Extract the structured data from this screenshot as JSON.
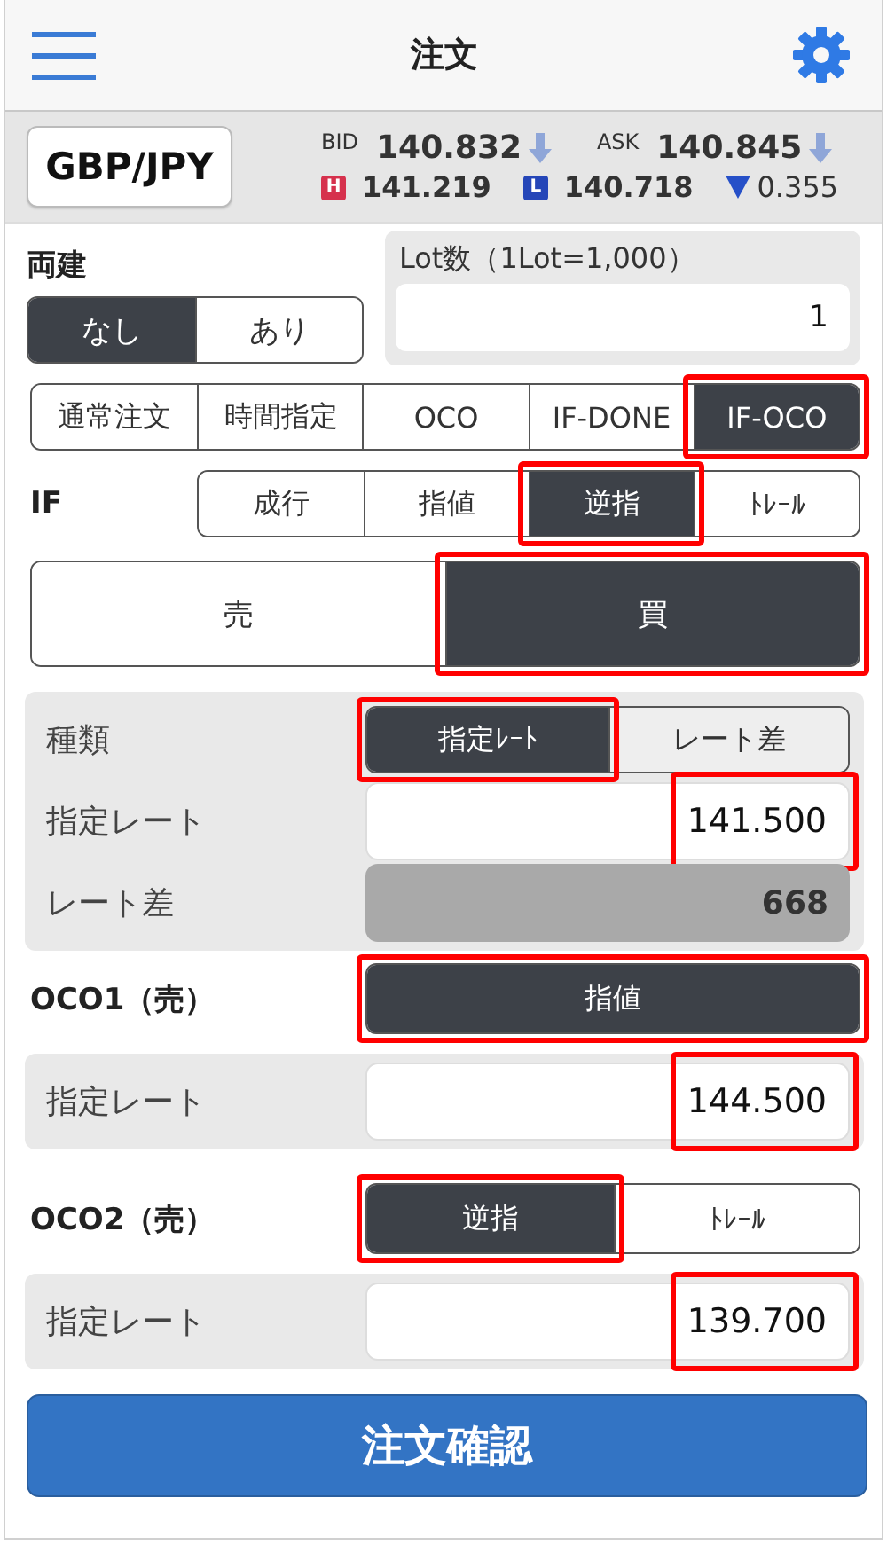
{
  "header": {
    "title": "注文"
  },
  "quote": {
    "pair": "GBP/JPY",
    "bid_label": "BID",
    "bid": "140.832",
    "bid_falling": true,
    "ask_label": "ASK",
    "ask": "140.845",
    "ask_falling": true,
    "high_badge": "H",
    "high": "141.219",
    "low_badge": "L",
    "low": "140.718",
    "change_falling": true,
    "change": "0.355"
  },
  "hedge": {
    "label": "両建",
    "options": [
      {
        "label": "なし",
        "selected": true
      },
      {
        "label": "あり",
        "selected": false
      }
    ]
  },
  "lot": {
    "label": "Lot数（1Lot=1,000）",
    "value": "1"
  },
  "order_types": [
    {
      "label": "通常注文",
      "selected": false,
      "highlighted": false
    },
    {
      "label": "時間指定",
      "selected": false,
      "highlighted": false
    },
    {
      "label": "OCO",
      "selected": false,
      "highlighted": false
    },
    {
      "label": "IF-DONE",
      "selected": false,
      "highlighted": false
    },
    {
      "label": "IF-OCO",
      "selected": true,
      "highlighted": true
    }
  ],
  "if_section": {
    "label": "IF",
    "methods": [
      {
        "label": "成行",
        "selected": false,
        "highlighted": false
      },
      {
        "label": "指値",
        "selected": false,
        "highlighted": false
      },
      {
        "label": "逆指",
        "selected": true,
        "highlighted": true
      },
      {
        "label": "ﾄﾚｰﾙ",
        "selected": false,
        "highlighted": false
      }
    ]
  },
  "sides": [
    {
      "label": "売",
      "selected": false,
      "highlighted": false
    },
    {
      "label": "買",
      "selected": true,
      "highlighted": true
    }
  ],
  "if_rate_panel": {
    "rows": [
      {
        "kind": "segmented",
        "label": "種類",
        "options": [
          {
            "label": "指定ﾚｰﾄ",
            "selected": true,
            "highlighted": true
          },
          {
            "label": "レート差",
            "selected": false,
            "highlighted": false
          }
        ]
      },
      {
        "kind": "input",
        "label": "指定レート",
        "value": "141.500",
        "highlighted": true
      },
      {
        "kind": "readonly",
        "label": "レート差",
        "value": "668"
      }
    ]
  },
  "oco1": {
    "label": "OCO1（売）",
    "methods": [
      {
        "label": "指値",
        "selected": true,
        "highlighted": true
      }
    ],
    "rate": {
      "label": "指定レート",
      "value": "144.500",
      "highlighted": true
    }
  },
  "oco2": {
    "label": "OCO2（売）",
    "methods": [
      {
        "label": "逆指",
        "selected": true,
        "highlighted": true
      },
      {
        "label": "ﾄﾚｰﾙ",
        "selected": false,
        "highlighted": false
      }
    ],
    "rate": {
      "label": "指定レート",
      "value": "139.700",
      "highlighted": true
    }
  },
  "confirm_button": "注文確認"
}
